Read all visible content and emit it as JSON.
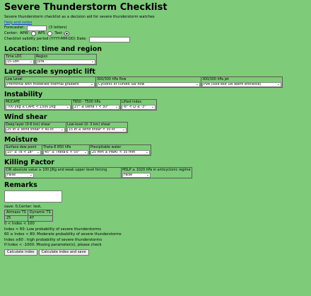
{
  "title": "Severe Thunderstorm Checklist",
  "intro": "Severe thunderstorm checklist as a decision aid for severe thunderstorm watches",
  "help_link": "Help and notes",
  "forecaster": {
    "label": "Forecaster:",
    "value": "",
    "hint": "(3 letters)"
  },
  "center": {
    "label": "Center:",
    "options": [
      "APW",
      "APS",
      "Test"
    ],
    "selected": "Test"
  },
  "validity": {
    "label": "Checklist validity period (YYYY-MM-DD) Date:",
    "value": ""
  },
  "location": {
    "heading": "Location: time and region",
    "time_label": "Time LDC",
    "time_value": "15-18h",
    "region_label": "Region",
    "region_value": "Jura"
  },
  "synoptic": {
    "heading": "Large-scale synoptic lift",
    "low_label": "Low Level",
    "low_value": "Prefrontal with moderate thermal gradient",
    "flow_label": "300/300 hPa flow",
    "flow_value": "Cyclonic or curved SW flow",
    "jet_label": "300/300 hPa jet",
    "jet_value": "PVA (cold exit OR warm entrance)"
  },
  "instability": {
    "heading": "Instability",
    "mucape_label": "MUCAPE",
    "mucape_value": "700 j/kg ≤ CAPE < 1500 j/kg",
    "t850_label": "T850 - T500 hPa",
    "t850_value": "27° ≤ Delta T < 30°",
    "li_label": "Lifted index",
    "li_value": "-6° < LI ≤ -3°"
  },
  "shear": {
    "heading": "Wind shear",
    "deep_label": "Deep layer (0-6 km) shear",
    "deep_value": "25 kt ≤ Wind shear < 40 kt",
    "low_label": "Low-level (0- 3 km) shear",
    "low_value": "15 kt ≤ Wind shear < 30 kt"
  },
  "moisture": {
    "heading": "Moisture",
    "dew_label": "Surface dew point",
    "dew_value": "15° ≤ Td < 18°",
    "theta_label": "Theta-E 850 hPa",
    "theta_value": "45° ≤ Theta-E < 55°",
    "pw_label": "Precipitable water",
    "pw_value": "25 mm ≤ PWAT < 35 mm"
  },
  "killing": {
    "heading": "Killing Factor",
    "cin_label": "CIN absolute value ≥ 100 J/Kg and weak upper level forcing",
    "cin_value": "False",
    "mslp_label": "MSLP ≥ 1020 hPa in anticyclonic regime",
    "mslp_value": "False"
  },
  "remarks": {
    "heading": "Remarks",
    "value": ""
  },
  "save_text": "save: 0,Center: test,",
  "results": {
    "headers": [
      "Airmass TS",
      "Dynamic TS"
    ],
    "values": [
      "25",
      "47"
    ]
  },
  "index_lines": [
    "0 < Index < 100",
    "Index < 60: Low probability of severe thunderstorms",
    "60 ≤ Index < 80: Moderate probability of severe thunderstorms",
    "Index ≥80 : high probability of severe thunderstorms",
    "If Index < -1000: Missing parameter(s), please check"
  ],
  "buttons": {
    "calc": "Calculate index",
    "calc_save": "Calculate index and save"
  }
}
